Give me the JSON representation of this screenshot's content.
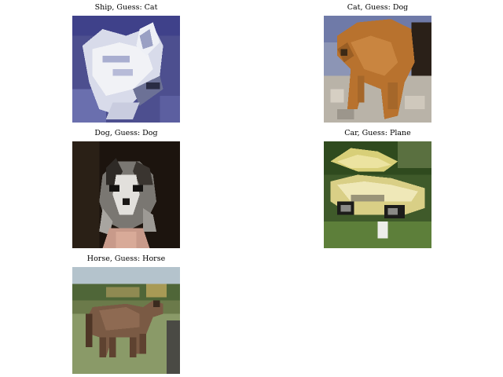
{
  "figure": {
    "panels": [
      {
        "label": "Ship, Guess: Cat",
        "image_subject": "ship"
      },
      {
        "label": "Cat, Guess: Dog",
        "image_subject": "cat"
      },
      {
        "label": "Dog, Guess: Dog",
        "image_subject": "dog"
      },
      {
        "label": "Car, Guess: Plane",
        "image_subject": "car"
      },
      {
        "label": "Horse, Guess: Horse",
        "image_subject": "horse"
      }
    ]
  }
}
